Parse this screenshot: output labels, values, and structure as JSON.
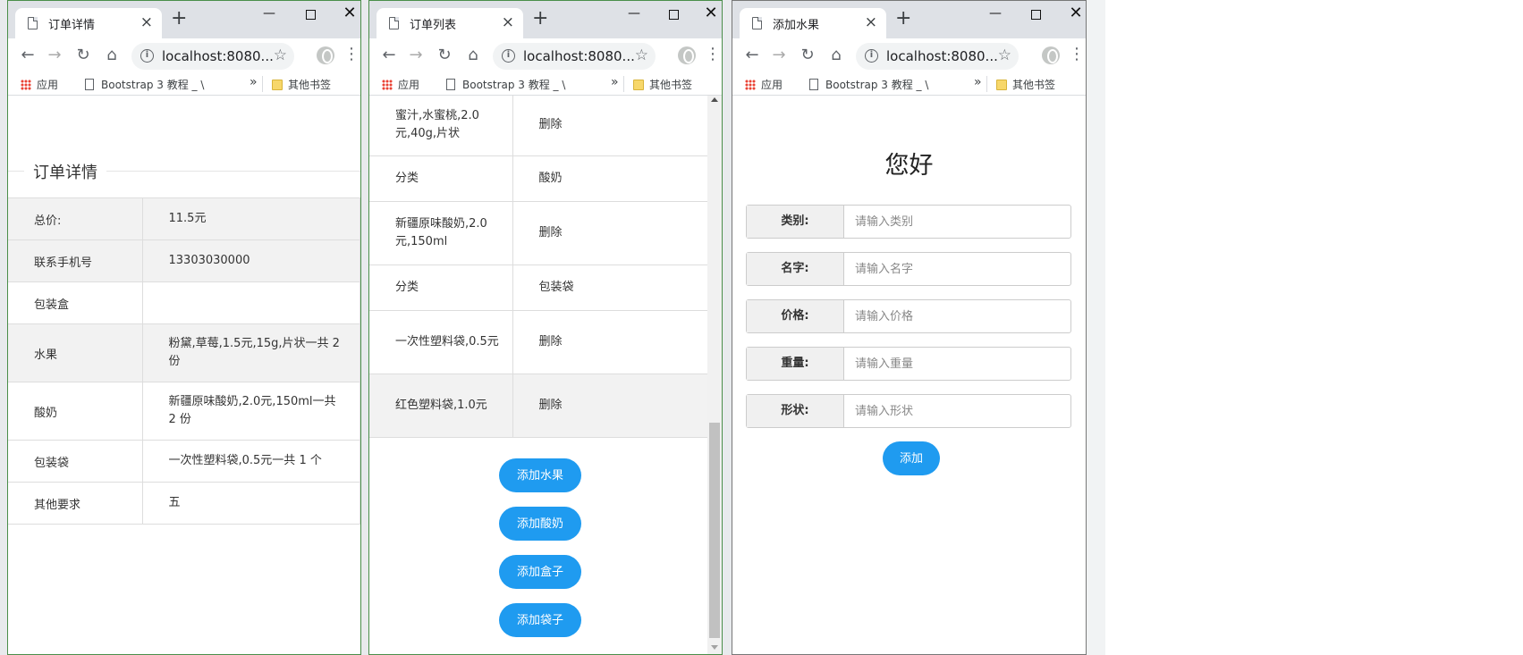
{
  "windows": [
    {
      "tab_title": "订单详情",
      "url": "localhost:8080...",
      "bookmarks": {
        "apps": "应用",
        "item": "Bootstrap 3 教程 _ \\",
        "other": "其他书签"
      },
      "legend": "订单详情",
      "rows": [
        {
          "key": "总价:",
          "value": "11.5元"
        },
        {
          "key": "联系手机号",
          "value": "13303030000"
        },
        {
          "key": "包装盒",
          "value": ""
        },
        {
          "key": "水果",
          "value": "粉黛,草莓,1.5元,15g,片状一共 2 份"
        },
        {
          "key": "酸奶",
          "value": "新疆原味酸奶,2.0元,150ml一共 2 份"
        },
        {
          "key": "包装袋",
          "value": "一次性塑料袋,0.5元一共 1 个"
        },
        {
          "key": "其他要求",
          "value": "五"
        }
      ]
    },
    {
      "tab_title": "订单列表",
      "url": "localhost:8080...",
      "bookmarks": {
        "apps": "应用",
        "item": "Bootstrap 3 教程 _ \\",
        "other": "其他书签"
      },
      "rows": [
        {
          "a": "蜜汁,水蜜桃,2.0元,40g,片状",
          "b": "删除"
        },
        {
          "a": "分类",
          "b": "酸奶"
        },
        {
          "a": "新疆原味酸奶,2.0元,150ml",
          "b": "删除"
        },
        {
          "a": "分类",
          "b": "包装袋"
        },
        {
          "a": "一次性塑料袋,0.5元",
          "b": "删除"
        },
        {
          "a": "红色塑料袋,1.0元",
          "b": "删除"
        }
      ],
      "buttons": [
        "添加水果",
        "添加酸奶",
        "添加盒子",
        "添加袋子"
      ]
    },
    {
      "tab_title": "添加水果",
      "url": "localhost:8080...",
      "bookmarks": {
        "apps": "应用",
        "item": "Bootstrap 3 教程 _ \\",
        "other": "其他书签"
      },
      "greeting": "您好",
      "fields": [
        {
          "label": "类别:",
          "placeholder": "请输入类别"
        },
        {
          "label": "名字:",
          "placeholder": "请输入名字"
        },
        {
          "label": "价格:",
          "placeholder": "请输入价格"
        },
        {
          "label": "重量:",
          "placeholder": "请输入重量"
        },
        {
          "label": "形状:",
          "placeholder": "请输入形状"
        }
      ],
      "submit": "添加"
    }
  ],
  "icons": {
    "tab_close": "×",
    "new_tab": "+",
    "minimize": "—",
    "close": "✕",
    "back": "←",
    "forward": "→",
    "reload": "↻",
    "home": "⌂",
    "info": "i",
    "star": "☆",
    "kebab": "⋮",
    "chevron": "»"
  },
  "colors": {
    "accent": "#1f9bf0",
    "titlebar": "#dee1e6",
    "row_alt": "#f2f2f2"
  }
}
